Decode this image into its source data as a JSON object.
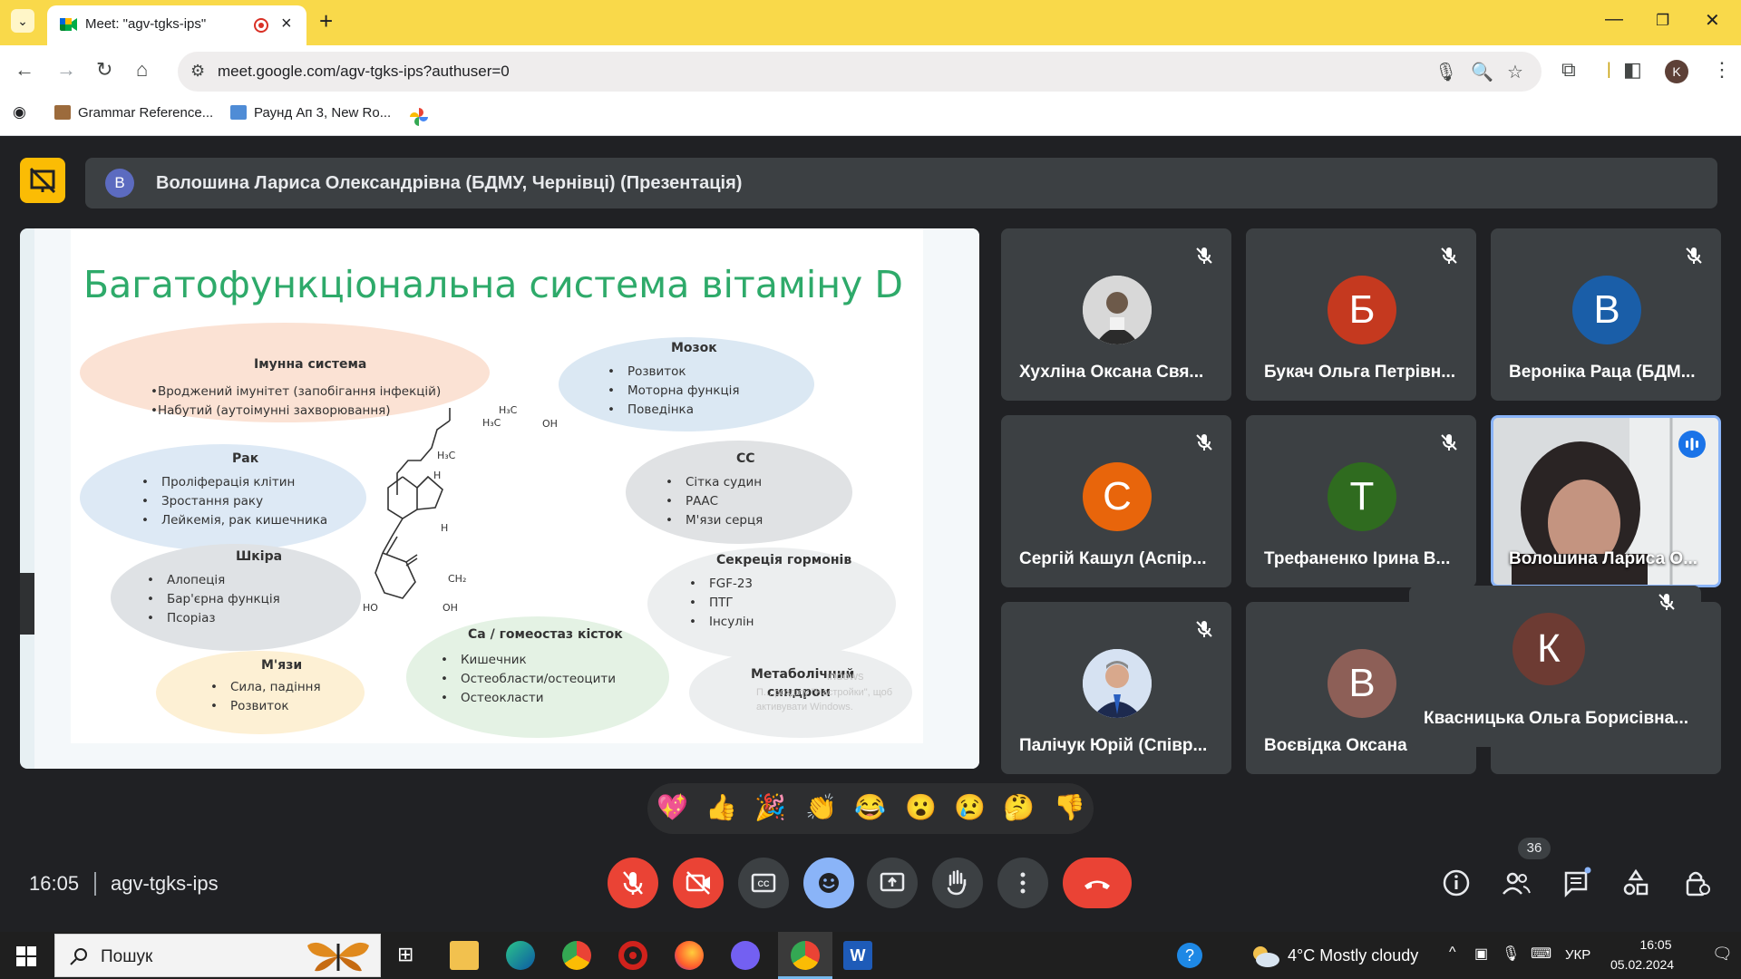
{
  "browser": {
    "tab_title": "Meet: \"agv-tgks-ips\"",
    "url": "meet.google.com/agv-tgks-ips?authuser=0",
    "profile_initial": "K",
    "bookmarks": [
      "Grammar Reference...",
      "Раунд Ап 3, New Ro..."
    ]
  },
  "meet": {
    "presenter_initial": "В",
    "presenter_title": "Волошина Лариса Олександрівна (БДМУ, Чернівці) (Презентація)",
    "time": "16:05",
    "meeting_code": "agv-tgks-ips",
    "people_count": "36"
  },
  "slide": {
    "title": "Багатофункціональна система вітаміну D",
    "immune": {
      "title": "Імунна система",
      "items": [
        "•Вроджений імунітет (запобігання інфекцій)",
        "•Набутий (аутоімунні захворювання)"
      ]
    },
    "brain": {
      "title": "Мозок",
      "items": [
        "Розвиток",
        "Моторна функція",
        "Поведінка"
      ]
    },
    "cancer": {
      "title": "Рак",
      "items": [
        "Проліферація клітин",
        "Зростання раку",
        "Лейкемія, рак кишечника"
      ]
    },
    "cv": {
      "title": "СС",
      "items": [
        "Сітка судин",
        "РААС",
        "М'язи серця"
      ]
    },
    "skin": {
      "title": "Шкіра",
      "items": [
        "Алопеція",
        "Бар'єрна функція",
        "Псоріаз"
      ]
    },
    "hormones": {
      "title": "Секреція гормонів",
      "items": [
        "FGF-23",
        "ПТГ",
        "Інсулін"
      ]
    },
    "muscle": {
      "title": "М'язи",
      "items": [
        "Сила, падіння",
        "Розвиток"
      ]
    },
    "bone": {
      "title": "Са / гомеостаз кісток",
      "items": [
        "Кишечник",
        "Остеобласти/остеоцити",
        "Остеокласти"
      ]
    },
    "metabolic": {
      "title_line1": "Метаболічний",
      "title_line2": "синдром"
    },
    "molecule_labels": {
      "h3c_top": "H₃C",
      "oh_top": "OH",
      "h3c_left": "H₃C",
      "h3c_mid": "H₃C",
      "h_mid": "H",
      "h_low": "H",
      "ch2": "CH₂",
      "ho": "HO",
      "oh_bottom": "OH"
    },
    "watermark_line1": "indows",
    "watermark_line2": "П... розділу \"Настройки\", щоб",
    "watermark_line3": "активувати Windows."
  },
  "participants": [
    {
      "name": "Хухліна Оксана Свя...",
      "initial": "",
      "color": "#c9c9c9",
      "photo": true
    },
    {
      "name": "Букач Ольга Петрівн...",
      "initial": "Б",
      "color": "#c5391f"
    },
    {
      "name": "Вероніка Раца (БДМ...",
      "initial": "В",
      "color": "#1a5ea8"
    },
    {
      "name": "Сергій Кашул (Аспір...",
      "initial": "С",
      "color": "#e8650b"
    },
    {
      "name": "Трефаненко Ірина В...",
      "initial": "Т",
      "color": "#2f6b1f"
    },
    {
      "name": "Волошина Лариса О...",
      "initial": "",
      "color": "#d7d7d7",
      "photo": true
    },
    {
      "name": "Палічук Юрій (Співр...",
      "initial": "",
      "color": "#c9d3e6",
      "photo": true
    },
    {
      "name": "Воєвідка Оксана",
      "initial": "В",
      "color": "#8d5f57"
    },
    {
      "name": "Квасницька Ольга Борисівна...",
      "initial": "К",
      "color": "#6d3b33"
    }
  ],
  "reactions": [
    "💖",
    "👍",
    "🎉",
    "👏",
    "😂",
    "😮",
    "😢",
    "🤔",
    "👎"
  ],
  "taskbar": {
    "search_placeholder": "Пошук",
    "weather": "4°C  Mostly cloudy",
    "language": "УКР",
    "clock_time": "16:05",
    "clock_date": "05.02.2024"
  }
}
